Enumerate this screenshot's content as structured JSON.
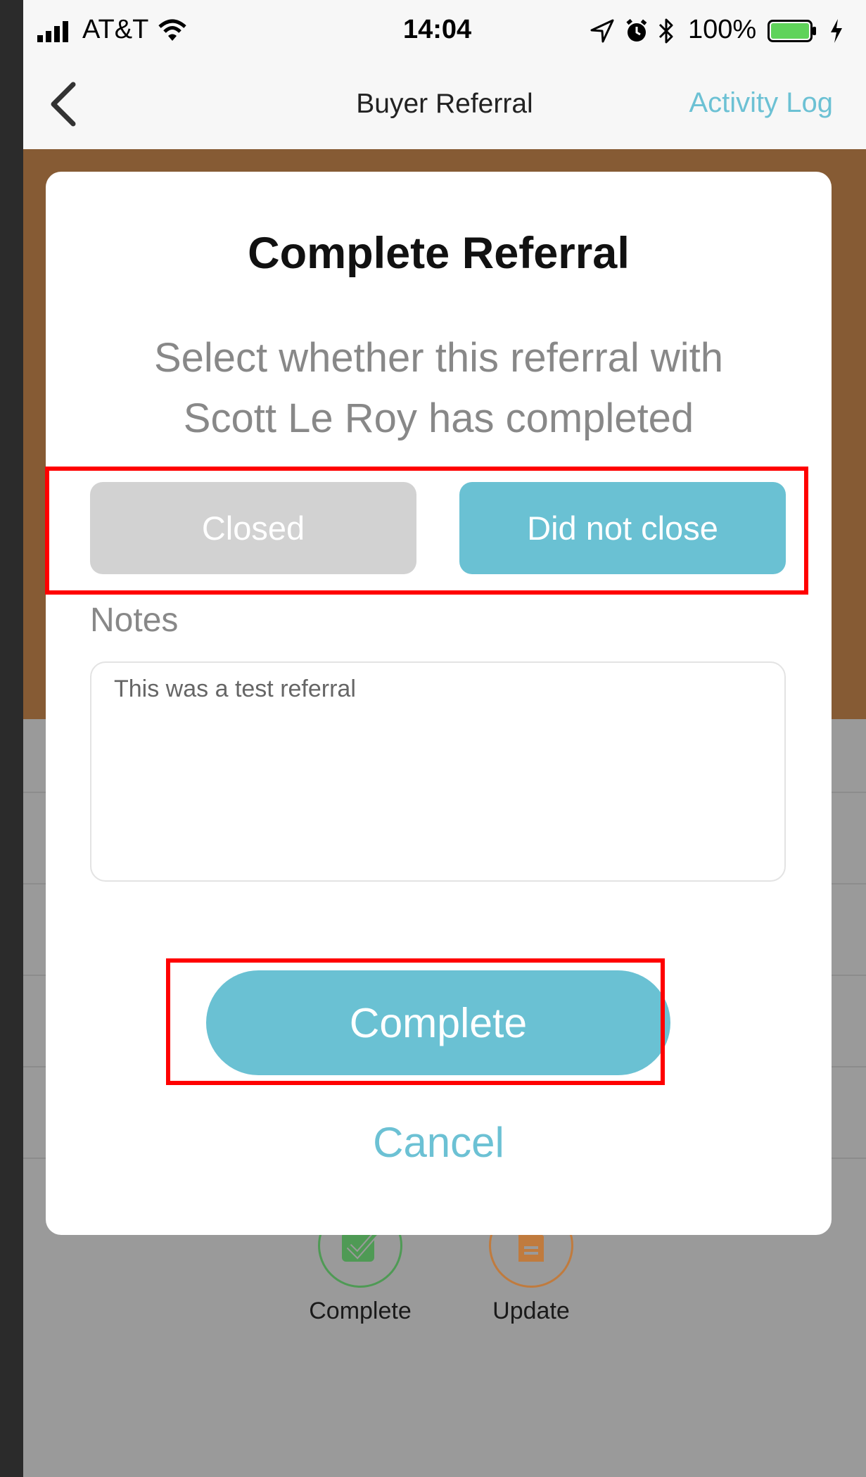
{
  "status_bar": {
    "carrier": "AT&T",
    "time": "14:04",
    "battery_percent": "100%",
    "battery_level": 1.0,
    "icons": [
      "signal-icon",
      "wifi-icon",
      "location-icon",
      "alarm-icon",
      "bluetooth-icon",
      "battery-icon",
      "charging-icon"
    ]
  },
  "nav": {
    "back_icon": "chevron-left-icon",
    "title": "Buyer Referral",
    "activity_log": "Activity Log"
  },
  "background": {
    "actions": [
      {
        "label": "Complete",
        "icon": "checkmark-icon",
        "color": "#4f9a55"
      },
      {
        "label": "Update",
        "icon": "document-icon",
        "color": "#c07b3e"
      }
    ]
  },
  "modal": {
    "title": "Complete Referral",
    "subtitle": "Select whether this referral with Scott Le Roy has completed",
    "options": [
      {
        "label": "Closed",
        "selected": false
      },
      {
        "label": "Did not close",
        "selected": true
      }
    ],
    "notes_label": "Notes",
    "notes_value": "This was a test referral",
    "complete_label": "Complete",
    "cancel_label": "Cancel"
  },
  "colors": {
    "accent": "#6ac1d3",
    "header_brown": "#865b34",
    "highlight": "#ff0000",
    "option_inactive": "#d2d2d2"
  }
}
